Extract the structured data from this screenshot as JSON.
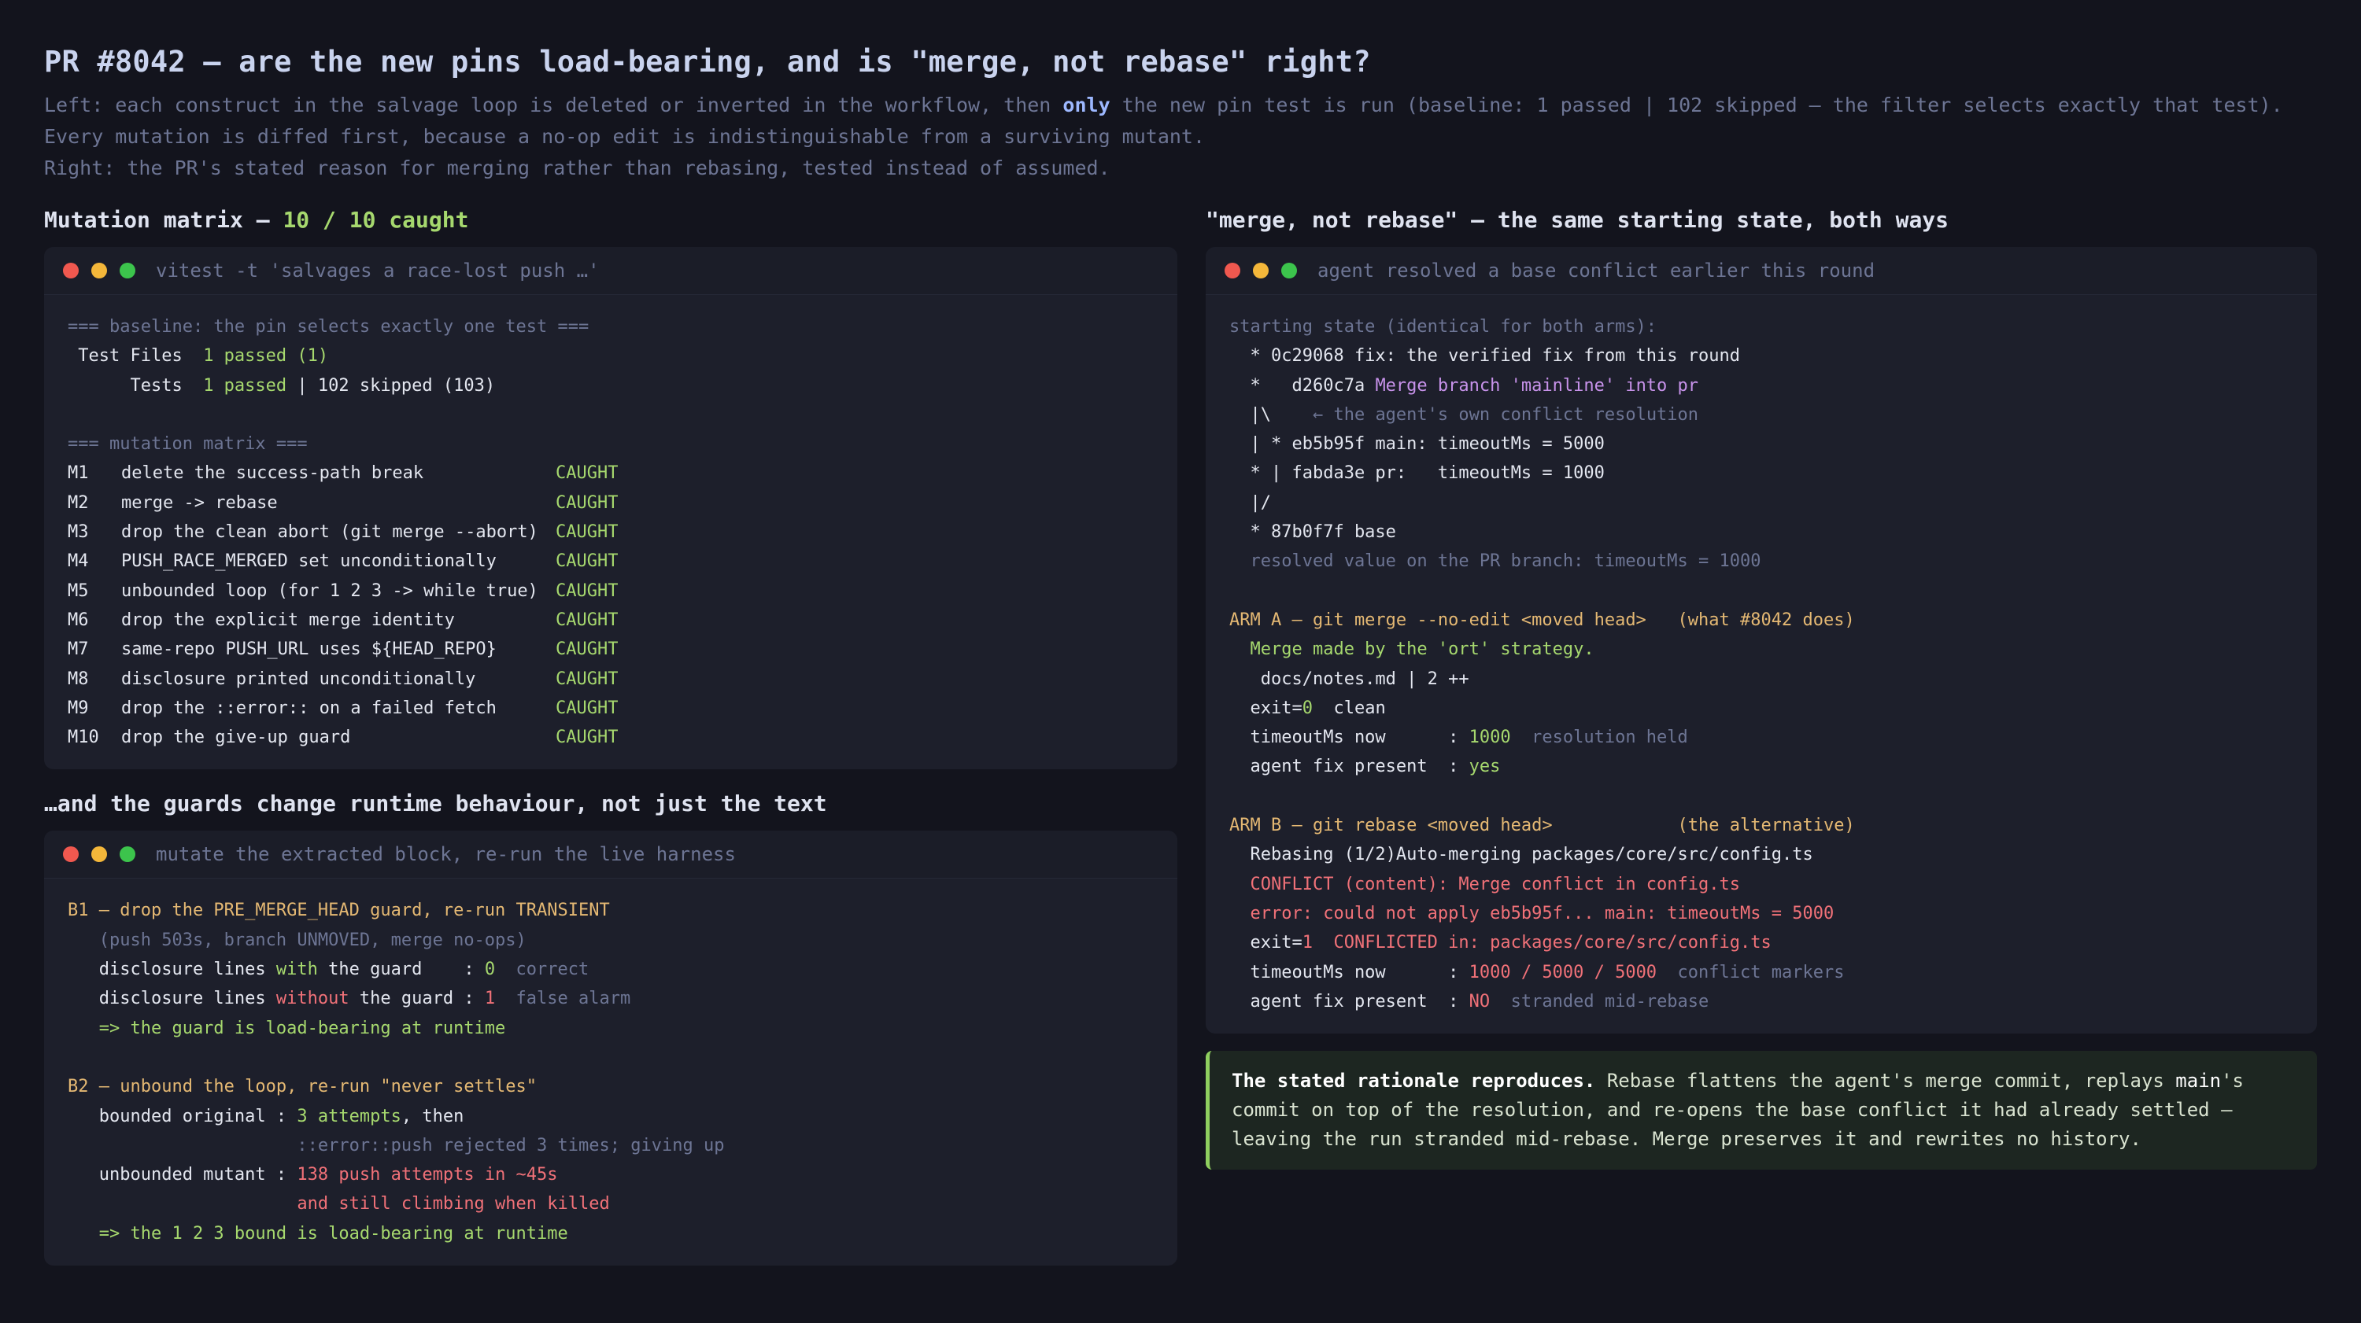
{
  "header": {
    "title": "PR #8042 — are the new pins load-bearing, and is \"merge, not rebase\" right?",
    "intro1_pre": "Left: each construct in the salvage loop is deleted or inverted in the workflow, then ",
    "intro1_hl": "only",
    "intro1_post": " the new pin test is run (baseline: 1 passed | 102 skipped — the filter selects exactly that test).",
    "intro2": "Every mutation is diffed first, because a no-op edit is indistinguishable from a surviving mutant.",
    "intro3": "Right: the PR's stated reason for merging rather than rebasing, tested instead of assumed."
  },
  "matrix": {
    "heading_pre": "Mutation matrix — ",
    "heading_count": "10 / 10 caught",
    "window_title": "vitest -t 'salvages a race-lost push …'",
    "baseline_header": "=== baseline: the pin selects exactly one test ===",
    "tf_label": " Test Files  ",
    "tf_value": "1 passed (1)",
    "tests_label": "      Tests  ",
    "tests_value": "1 passed",
    "tests_rest": " | 102 skipped (103)",
    "matrix_header": "=== mutation matrix ===",
    "rows": [
      {
        "id": "M1",
        "desc": "delete the success-path break",
        "result": "CAUGHT"
      },
      {
        "id": "M2",
        "desc": "merge -> rebase",
        "result": "CAUGHT"
      },
      {
        "id": "M3",
        "desc": "drop the clean abort (git merge --abort)",
        "result": "CAUGHT"
      },
      {
        "id": "M4",
        "desc": "PUSH_RACE_MERGED set unconditionally",
        "result": "CAUGHT"
      },
      {
        "id": "M5",
        "desc": "unbounded loop (for 1 2 3 -> while true)",
        "result": "CAUGHT"
      },
      {
        "id": "M6",
        "desc": "drop the explicit merge identity",
        "result": "CAUGHT"
      },
      {
        "id": "M7",
        "desc": "same-repo PUSH_URL uses ${HEAD_REPO}",
        "result": "CAUGHT"
      },
      {
        "id": "M8",
        "desc": "disclosure printed unconditionally",
        "result": "CAUGHT"
      },
      {
        "id": "M9",
        "desc": "drop the ::error:: on a failed fetch",
        "result": "CAUGHT"
      },
      {
        "id": "M10",
        "desc": "drop the give-up guard",
        "result": "CAUGHT"
      }
    ]
  },
  "guards": {
    "heading": "…and the guards change runtime behaviour, not just the text",
    "window_title": "mutate the extracted block, re-run the live harness",
    "b1_title": "B1 — drop the PRE_MERGE_HEAD guard, re-run TRANSIENT",
    "b1_sub": "   (push 503s, branch UNMOVED, merge no-ops)",
    "b1_with_pre": "   disclosure lines ",
    "b1_with_word": "with",
    "b1_with_post": " the guard    : ",
    "b1_with_val": "0",
    "b1_with_note": "  correct",
    "b1_without_pre": "   disclosure lines ",
    "b1_without_word": "without",
    "b1_without_post": " the guard : ",
    "b1_without_val": "1",
    "b1_without_note": "  false alarm",
    "b1_conclusion": "   => the guard is load-bearing at runtime",
    "b2_title": "B2 — unbound the loop, re-run \"never settles\"",
    "b2_bounded_label": "   bounded original : ",
    "b2_bounded_val": "3 attempts",
    "b2_bounded_post": ", then",
    "b2_bounded_cont": "                      ::error::push rejected 3 times; giving up",
    "b2_unbounded_label": "   unbounded mutant : ",
    "b2_unbounded_val": "138 push attempts in ~45s",
    "b2_unbounded_cont": "                      and still climbing when killed",
    "b2_conclusion": "   => the 1 2 3 bound is load-bearing at runtime"
  },
  "rebase": {
    "heading": "\"merge, not rebase\" — the same starting state, both ways",
    "window_title": "agent resolved a base conflict earlier this round",
    "start_header": "starting state (identical for both arms):",
    "g1": "  * 0c29068 fix: the verified fix from this round",
    "g2_pre": "  *   d260c7a ",
    "g2_purple": "Merge branch 'mainline' into pr",
    "g3_pre": "  |\\    ",
    "g3_note": "← the agent's own conflict resolution",
    "g4": "  | * eb5b95f main: timeoutMs = 5000",
    "g5": "  * | fabda3e pr:   timeoutMs = 1000",
    "g6": "  |/",
    "g7": "  * 87b0f7f base",
    "g8": "  resolved value on the PR branch: timeoutMs = 1000",
    "a_title": "ARM A — git merge --no-edit <moved head>   (what #8042 does)",
    "a1": "  Merge made by the 'ort' strategy.",
    "a2": "   docs/notes.md | 2 ++",
    "a3_pre": "  exit=",
    "a3_val": "0",
    "a3_post": "  clean",
    "a4_label": "  timeoutMs now      : ",
    "a4_val": "1000",
    "a4_note": "  resolution held",
    "a5_label": "  agent fix present  : ",
    "a5_val": "yes",
    "b_title": "ARM B — git rebase <moved head>            (the alternative)",
    "b1": "  Rebasing (1/2)Auto-merging packages/core/src/config.ts",
    "b2": "  CONFLICT (content): Merge conflict in config.ts",
    "b3": "  error: could not apply eb5b95f... main: timeoutMs = 5000",
    "b4_pre": "  exit=",
    "b4_val": "1",
    "b4_post": "  CONFLICTED in: packages/core/src/config.ts",
    "b5_label": "  timeoutMs now      : ",
    "b5_val": "1000 / 5000 / 5000",
    "b5_note": "  conflict markers",
    "b6_label": "  agent fix present  : ",
    "b6_val": "NO",
    "b6_note": "  stranded mid-rebase"
  },
  "rationale": {
    "bold": "The stated rationale reproduces.",
    "t1": " Rebase flattens the agent's merge commit, replays ",
    "mono": "main",
    "t2": "'s commit on top of the resolution, and re-opens the base conflict it had already settled — leaving the run stranded mid-rebase. Merge preserves it and rewrites no history."
  },
  "colors": {
    "background": "#13141d",
    "panel": "#1d1f2b",
    "caught": "#a6d86e",
    "warning": "#e4b873",
    "error": "#f07178"
  }
}
